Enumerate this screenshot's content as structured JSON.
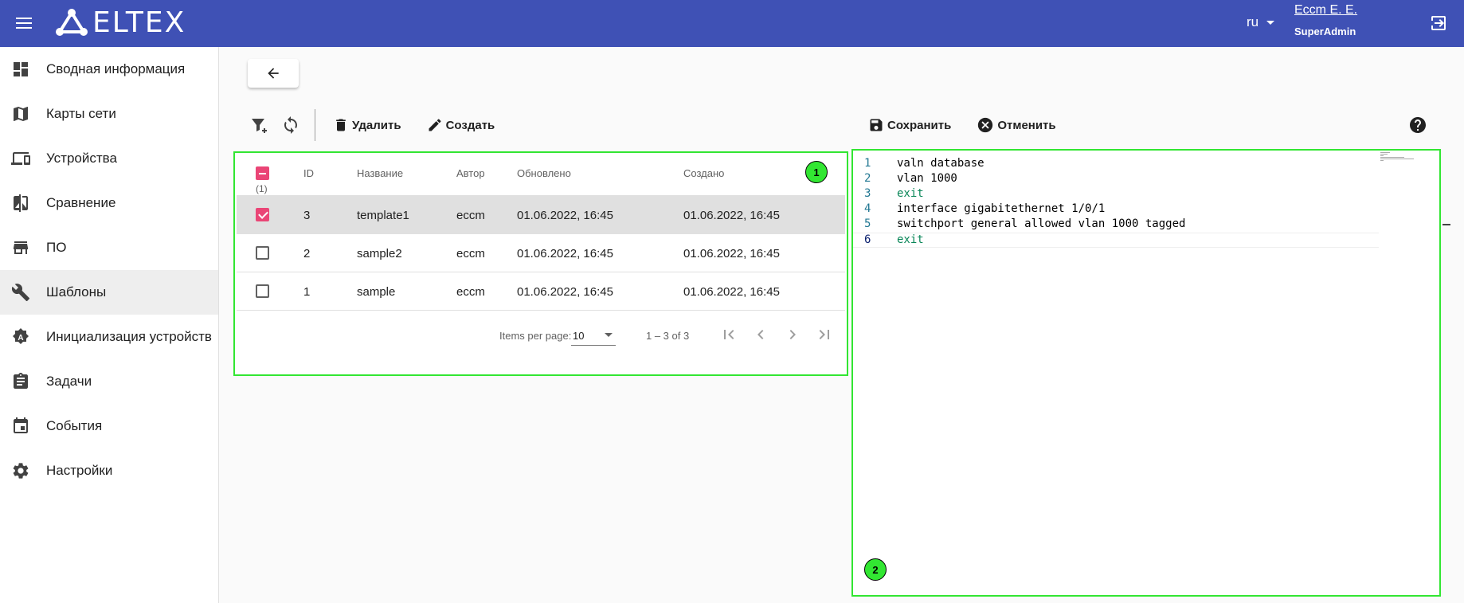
{
  "header": {
    "brand": "ELTEX",
    "language": "ru",
    "user_name": "Eccm E. E.",
    "user_role": "SuperAdmin"
  },
  "sidebar": {
    "items": [
      {
        "label": "Сводная информация",
        "icon": "dashboard-icon"
      },
      {
        "label": "Карты сети",
        "icon": "map-icon"
      },
      {
        "label": "Устройства",
        "icon": "devices-icon"
      },
      {
        "label": "Сравнение",
        "icon": "compare-icon"
      },
      {
        "label": "ПО",
        "icon": "store-icon"
      },
      {
        "label": "Шаблоны",
        "icon": "wrench-icon",
        "active": true
      },
      {
        "label": "Инициализация устройств",
        "icon": "auto-init-icon"
      },
      {
        "label": "Задачи",
        "icon": "clipboard-icon"
      },
      {
        "label": "События",
        "icon": "calendar-icon"
      },
      {
        "label": "Настройки",
        "icon": "gear-icon"
      }
    ]
  },
  "toolbar": {
    "delete_label": "Удалить",
    "create_label": "Создать"
  },
  "editor_toolbar": {
    "save_label": "Сохранить",
    "cancel_label": "Отменить"
  },
  "table": {
    "selected_count": "(1)",
    "columns": {
      "id": "ID",
      "name": "Название",
      "author": "Автор",
      "updated": "Обновлено",
      "created": "Создано"
    },
    "rows": [
      {
        "checked": true,
        "id": "3",
        "name": "template1",
        "author": "eccm",
        "updated": "01.06.2022, 16:45",
        "created": "01.06.2022, 16:45"
      },
      {
        "checked": false,
        "id": "2",
        "name": "sample2",
        "author": "eccm",
        "updated": "01.06.2022, 16:45",
        "created": "01.06.2022, 16:45"
      },
      {
        "checked": false,
        "id": "1",
        "name": "sample",
        "author": "eccm",
        "updated": "01.06.2022, 16:45",
        "created": "01.06.2022, 16:45"
      }
    ],
    "pager": {
      "items_per_page_label": "Items per page:",
      "items_per_page_value": "10",
      "range": "1 – 3 of 3"
    }
  },
  "editor": {
    "lines": [
      {
        "num": "1",
        "text": "valn database",
        "kw": false
      },
      {
        "num": "2",
        "text": "vlan 1000",
        "kw": false
      },
      {
        "num": "3",
        "text": "exit",
        "kw": true
      },
      {
        "num": "4",
        "text": "interface gigabitethernet 1/0/1",
        "kw": false
      },
      {
        "num": "5",
        "text": "switchport general allowed vlan 1000 tagged",
        "kw": false
      },
      {
        "num": "6",
        "text": "exit",
        "kw": true
      }
    ]
  },
  "annotations": {
    "badge_1": "1",
    "badge_2": "2"
  },
  "colors": {
    "header": "#3f51b5",
    "accent_checkbox": "#ea4576",
    "highlight_outline": "#32e632"
  }
}
